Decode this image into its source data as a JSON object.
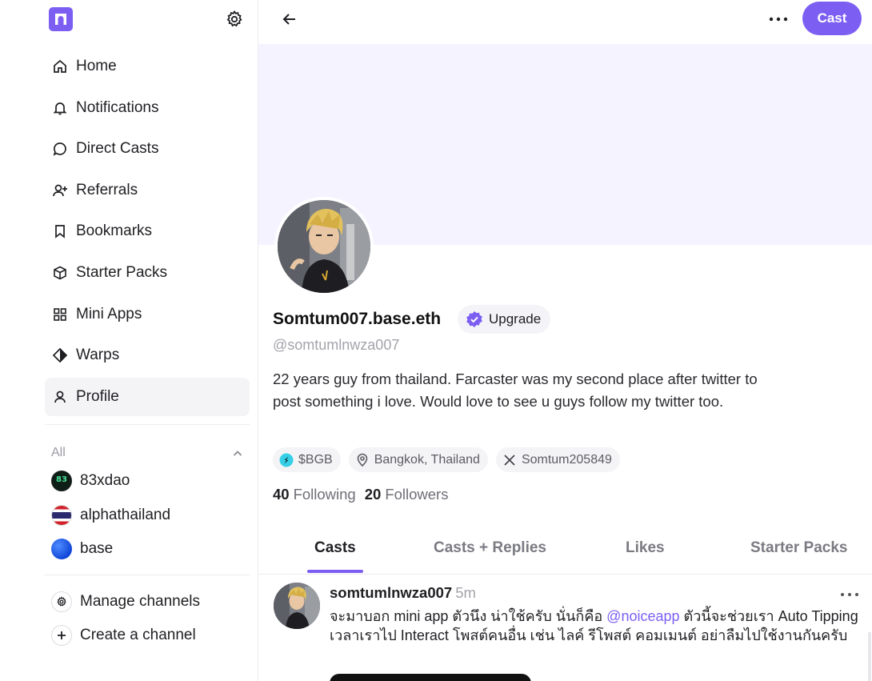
{
  "sidebar": {
    "nav": [
      {
        "label": "Home",
        "icon": "home-icon"
      },
      {
        "label": "Notifications",
        "icon": "bell-icon"
      },
      {
        "label": "Direct Casts",
        "icon": "chat-bubble-icon"
      },
      {
        "label": "Referrals",
        "icon": "user-plus-icon"
      },
      {
        "label": "Bookmarks",
        "icon": "bookmark-icon"
      },
      {
        "label": "Starter Packs",
        "icon": "package-icon"
      },
      {
        "label": "Mini Apps",
        "icon": "grid-icon"
      },
      {
        "label": "Warps",
        "icon": "diamond-icon"
      },
      {
        "label": "Profile",
        "icon": "user-icon",
        "active": true
      }
    ],
    "channels_label": "All",
    "channels": [
      {
        "name": "83xdao",
        "badge_text": "83"
      },
      {
        "name": "alphathailand"
      },
      {
        "name": "base"
      }
    ],
    "manage_channels": "Manage channels",
    "create_channel": "Create a channel"
  },
  "header": {
    "cast_button": "Cast"
  },
  "profile": {
    "display_name": "Somtum007.base.eth",
    "upgrade_label": "Upgrade",
    "handle": "@somtumlnwza007",
    "bio": "22 years guy from thailand. Farcaster was my second place after twitter to post something i love. Would love to see u guys follow my twitter too.",
    "chips": {
      "token": "$BGB",
      "location": "Bangkok, Thailand",
      "x_account": "Somtum205849"
    },
    "following_count": "40",
    "following_label": "Following",
    "followers_count": "20",
    "followers_label": "Followers"
  },
  "tabs": [
    "Casts",
    "Casts + Replies",
    "Likes",
    "Starter Packs"
  ],
  "active_tab": "Casts",
  "post": {
    "author": "somtumlnwza007",
    "time": "5m",
    "text_before": "จะมาบอก mini app ตัวนึง น่าใช้ครับ นั่นก็คือ ",
    "mention": "@noiceapp",
    "text_after": " ตัวนี้จะช่วยเรา Auto Tipping เวลาเราไป Interact โพสต์คนอื่น เช่น ไลค์ รีโพสต์ คอมเมนต์ อย่าลืมไปใช้งานกันครับ"
  },
  "colors": {
    "accent": "#7c5ff2",
    "banner": "#f5f3ff",
    "muted_text": "#a3a3ab"
  }
}
